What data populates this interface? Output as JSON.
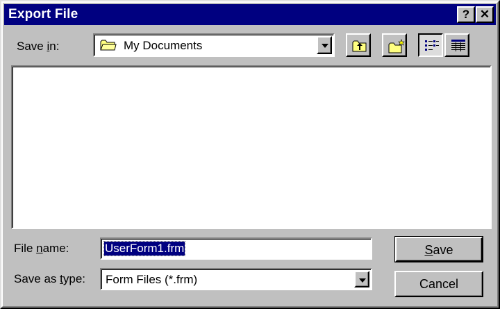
{
  "window": {
    "title": "Export File",
    "help_button": "?",
    "close_button": "✕"
  },
  "save_in": {
    "label_pre": "Save ",
    "label_accel": "i",
    "label_post": "n:",
    "value": "My Documents",
    "icon": "folder-icon"
  },
  "toolbar": {
    "buttons": [
      {
        "name": "up-one-level-button",
        "icon": "folder-up-icon"
      },
      {
        "name": "create-new-folder-button",
        "icon": "new-folder-icon"
      },
      {
        "name": "list-view-button",
        "icon": "list-view-icon",
        "pressed": true
      },
      {
        "name": "details-view-button",
        "icon": "details-view-icon",
        "pressed": false
      }
    ]
  },
  "file_list": {
    "items": []
  },
  "file_name": {
    "label_pre": "File ",
    "label_accel": "n",
    "label_post": "ame:",
    "value": "UserForm1.frm"
  },
  "save_as_type": {
    "label_pre": "Save as ",
    "label_accel": "t",
    "label_post": "ype:",
    "value": "Form Files (*.frm)"
  },
  "buttons": {
    "save_accel": "S",
    "save_rest": "ave",
    "cancel": "Cancel"
  },
  "colors": {
    "title_bar": "#000080",
    "face": "#c0c0c0",
    "selection": "#000080",
    "folder": "#ffff80"
  }
}
